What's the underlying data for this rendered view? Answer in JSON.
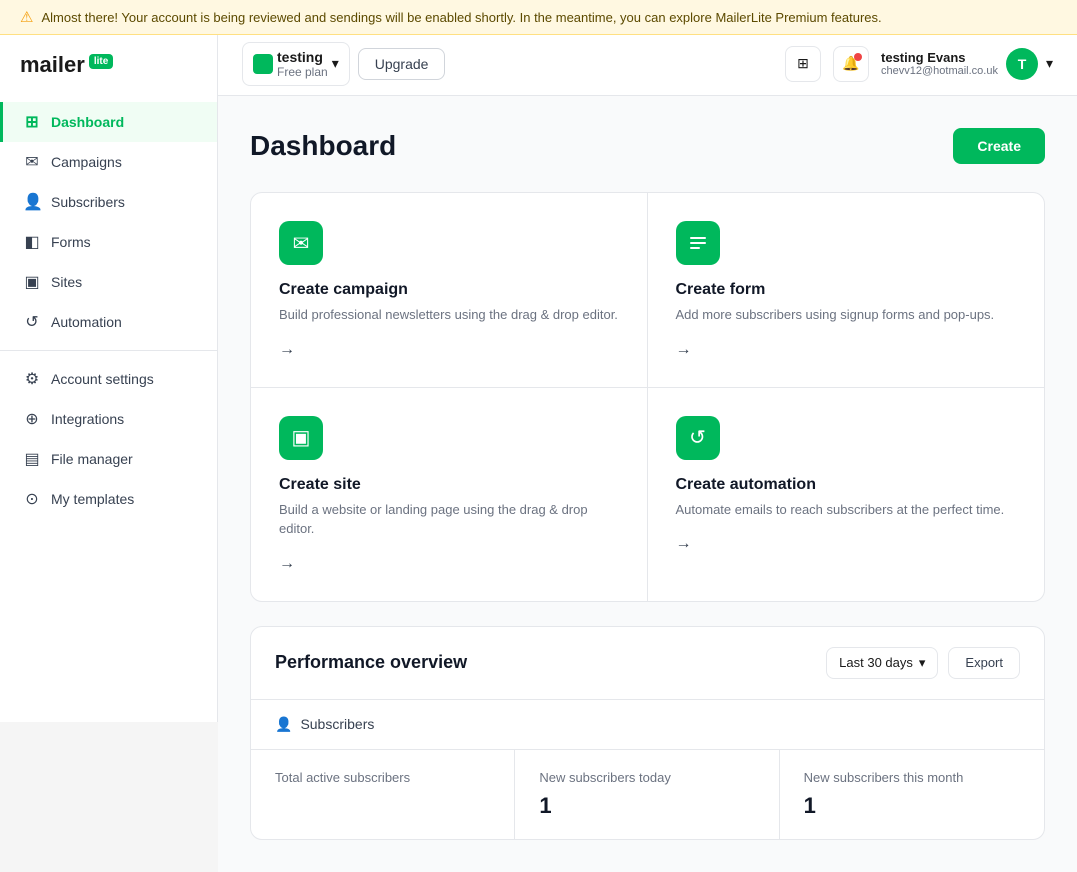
{
  "banner": {
    "text": "Almost there! Your account is being reviewed and sendings will be enabled shortly. In the meantime, you can explore MailerLite Premium features."
  },
  "logo": {
    "name": "mailer",
    "badge": "lite"
  },
  "sidebar": {
    "items": [
      {
        "id": "dashboard",
        "label": "Dashboard",
        "icon": "⊞",
        "active": true
      },
      {
        "id": "campaigns",
        "label": "Campaigns",
        "icon": "✉",
        "active": false
      },
      {
        "id": "subscribers",
        "label": "Subscribers",
        "icon": "👤",
        "active": false
      },
      {
        "id": "forms",
        "label": "Forms",
        "icon": "◧",
        "active": false
      },
      {
        "id": "sites",
        "label": "Sites",
        "icon": "▣",
        "active": false
      },
      {
        "id": "automation",
        "label": "Automation",
        "icon": "↺",
        "active": false
      },
      {
        "id": "account-settings",
        "label": "Account settings",
        "icon": "⚙",
        "active": false
      },
      {
        "id": "integrations",
        "label": "Integrations",
        "icon": "⊕",
        "active": false
      },
      {
        "id": "file-manager",
        "label": "File manager",
        "icon": "▤",
        "active": false
      },
      {
        "id": "my-templates",
        "label": "My templates",
        "icon": "⊙",
        "active": false
      }
    ]
  },
  "header": {
    "workspace": {
      "name": "testing",
      "plan": "Free plan"
    },
    "upgrade_label": "Upgrade",
    "user": {
      "name": "testing Evans",
      "email": "chevv12@hotmail.co.uk",
      "initials": "T"
    }
  },
  "page": {
    "title": "Dashboard",
    "create_label": "Create"
  },
  "cards": [
    {
      "id": "create-campaign",
      "title": "Create campaign",
      "desc": "Build professional newsletters using the drag & drop editor.",
      "icon": "✉"
    },
    {
      "id": "create-form",
      "title": "Create form",
      "desc": "Add more subscribers using signup forms and pop-ups.",
      "icon": "≡"
    },
    {
      "id": "create-site",
      "title": "Create site",
      "desc": "Build a website or landing page using the drag & drop editor.",
      "icon": "▣"
    },
    {
      "id": "create-automation",
      "title": "Create automation",
      "desc": "Automate emails to reach subscribers at the perfect time.",
      "icon": "↺"
    }
  ],
  "performance": {
    "title": "Performance overview",
    "period_label": "Last 30 days",
    "export_label": "Export",
    "subscribers_label": "Subscribers",
    "stats": [
      {
        "label": "Total active subscribers",
        "value": ""
      },
      {
        "label": "New subscribers today",
        "value": "1"
      },
      {
        "label": "New subscribers this month",
        "value": "1"
      }
    ]
  }
}
